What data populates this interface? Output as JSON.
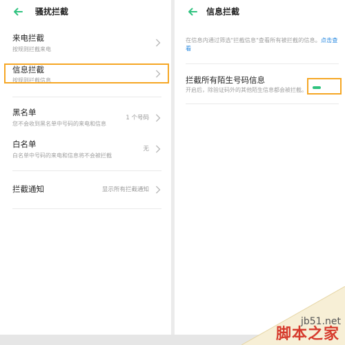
{
  "left": {
    "title": "骚扰拦截",
    "rows": [
      {
        "title": "来电拦截",
        "subtitle": "按规则拦截来电",
        "value": ""
      },
      {
        "title": "信息拦截",
        "subtitle": "按规则拦截信息",
        "value": ""
      },
      {
        "title": "黑名单",
        "subtitle": "您不会收到黑名单中号码的来电和信息",
        "value": "1 个号码"
      },
      {
        "title": "白名单",
        "subtitle": "白名单中号码的来电和信息将不会被拦截",
        "value": "无"
      },
      {
        "title": "拦截通知",
        "subtitle": "",
        "value": "显示所有拦截通知"
      }
    ]
  },
  "right": {
    "title": "信息拦截",
    "info_text": "在信息内通过筛选\"拦截信息\"查看所有被拦截的信息。",
    "info_link": "点击查看",
    "setting": {
      "title": "拦截所有陌生号码信息",
      "subtitle": "开启后，除验证码外的其他陌生信息都会被拦截。",
      "enabled": true
    }
  },
  "colors": {
    "accent": "#2ec27e",
    "highlight": "#f5a623",
    "link": "#2a8ae0"
  },
  "icons": {
    "back": "arrow-left-icon",
    "chevron": "chevron-right-icon"
  },
  "watermark": {
    "domain": "jb51.net",
    "name": "脚本之家"
  }
}
